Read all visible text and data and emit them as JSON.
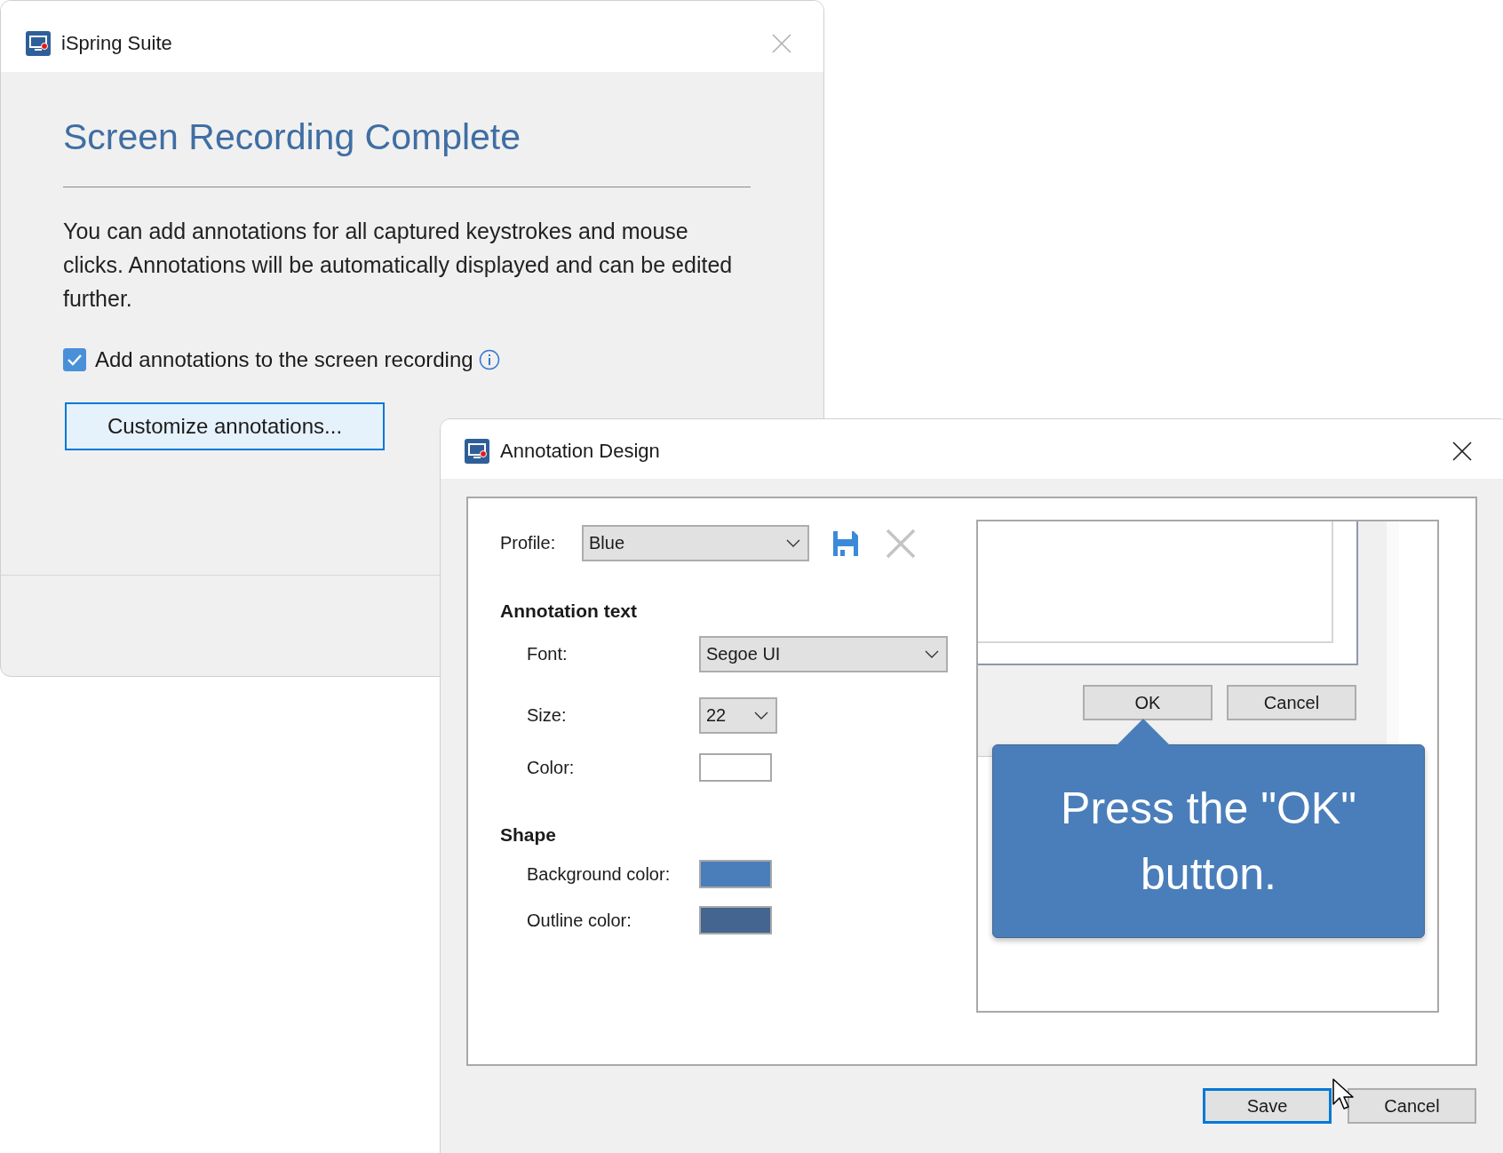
{
  "main_window": {
    "title": "iSpring Suite",
    "heading": "Screen Recording Complete",
    "description": "You can add annotations for all captured keystrokes and mouse clicks. Annotations will be automatically displayed and can be edited further.",
    "checkbox": {
      "label": "Add annotations to the screen recording",
      "checked": true
    },
    "customize_button": "Customize annotations..."
  },
  "design_dialog": {
    "title": "Annotation Design",
    "profile": {
      "label": "Profile:",
      "value": "Blue"
    },
    "annotation_text": {
      "heading": "Annotation text",
      "font": {
        "label": "Font:",
        "value": "Segoe UI"
      },
      "size": {
        "label": "Size:",
        "value": "22"
      },
      "color": {
        "label": "Color:",
        "color": "#ffffff"
      }
    },
    "shape": {
      "heading": "Shape",
      "background_color": {
        "label": "Background color:",
        "color": "#4a7ebb"
      },
      "outline_color": {
        "label": "Outline color:",
        "color": "#44658f"
      }
    },
    "preview": {
      "ok_button": "OK",
      "cancel_button": "Cancel",
      "callout": "Press the \"OK\" button."
    },
    "buttons": [
      {
        "label": "Save",
        "focused": true
      },
      {
        "label": "Cancel",
        "focused": false
      }
    ]
  }
}
